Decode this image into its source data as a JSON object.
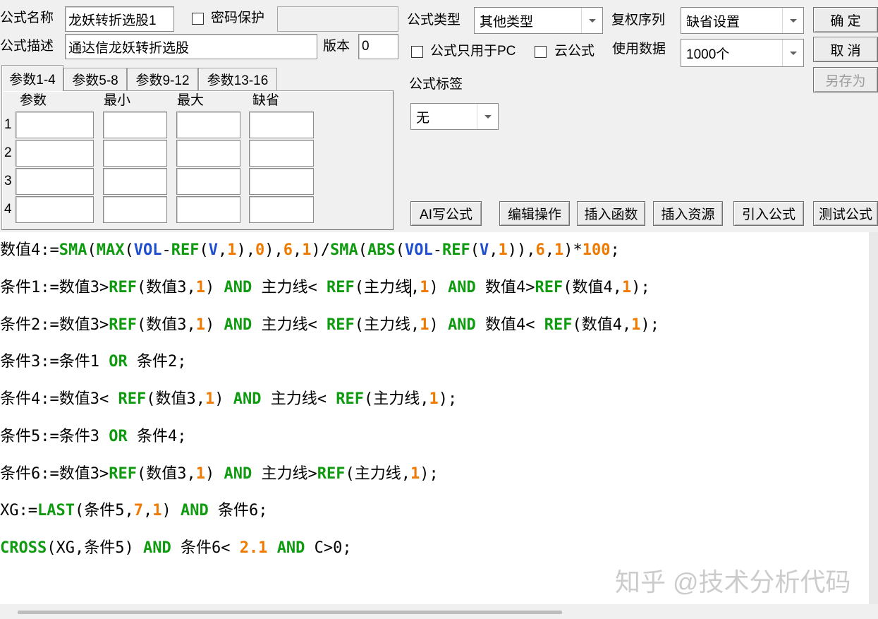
{
  "form": {
    "name_label": "公式名称",
    "name_value": "龙妖转折选股1",
    "password_label": "密码保护",
    "password_checked": false,
    "password_value": "",
    "desc_label": "公式描述",
    "desc_value": "通达信龙妖转折选股",
    "version_label": "版本",
    "version_value": "0",
    "type_label": "公式类型",
    "type_value": "其他类型",
    "adjust_label": "复权序列",
    "adjust_value": "缺省设置",
    "pc_only_label": "公式只用于PC",
    "pc_only_checked": false,
    "cloud_label": "云公式",
    "cloud_checked": false,
    "data_label": "使用数据",
    "data_value": "1000个",
    "tag_label": "公式标签",
    "tag_value": "无"
  },
  "buttons": {
    "ok": "确 定",
    "cancel": "取 消",
    "save_as": "另存为",
    "save_as_disabled": true,
    "ai_write": "AI写公式",
    "edit_ops": "编辑操作",
    "insert_function": "插入函数",
    "insert_resource": "插入资源",
    "import_formula": "引入公式",
    "test_formula": "测试公式"
  },
  "params": {
    "tabs": [
      {
        "label": "参数1-4",
        "active": true
      },
      {
        "label": "参数5-8",
        "active": false
      },
      {
        "label": "参数9-12",
        "active": false
      },
      {
        "label": "参数13-16",
        "active": false
      }
    ],
    "headers": {
      "name": "参数",
      "min": "最小",
      "max": "最大",
      "default": "缺省"
    },
    "rows": [
      {
        "index": "1",
        "name": "",
        "min": "",
        "max": "",
        "default": ""
      },
      {
        "index": "2",
        "name": "",
        "min": "",
        "max": "",
        "default": ""
      },
      {
        "index": "3",
        "name": "",
        "min": "",
        "max": "",
        "default": ""
      },
      {
        "index": "4",
        "name": "",
        "min": "",
        "max": "",
        "default": ""
      }
    ]
  },
  "editor": {
    "lines": [
      [
        {
          "s": "数值4:=",
          "k": "text"
        },
        {
          "s": "SMA",
          "k": "func"
        },
        {
          "s": "(",
          "k": "text"
        },
        {
          "s": "MAX",
          "k": "func"
        },
        {
          "s": "(",
          "k": "text"
        },
        {
          "s": "VOL",
          "k": "var"
        },
        {
          "s": "-",
          "k": "text"
        },
        {
          "s": "REF",
          "k": "func"
        },
        {
          "s": "(",
          "k": "text"
        },
        {
          "s": "V",
          "k": "var"
        },
        {
          "s": ",",
          "k": "text"
        },
        {
          "s": "1",
          "k": "num"
        },
        {
          "s": "),",
          "k": "text"
        },
        {
          "s": "0",
          "k": "num"
        },
        {
          "s": "),",
          "k": "text"
        },
        {
          "s": "6",
          "k": "num"
        },
        {
          "s": ",",
          "k": "text"
        },
        {
          "s": "1",
          "k": "num"
        },
        {
          "s": ")/",
          "k": "text"
        },
        {
          "s": "SMA",
          "k": "func"
        },
        {
          "s": "(",
          "k": "text"
        },
        {
          "s": "ABS",
          "k": "func"
        },
        {
          "s": "(",
          "k": "text"
        },
        {
          "s": "VOL",
          "k": "var"
        },
        {
          "s": "-",
          "k": "text"
        },
        {
          "s": "REF",
          "k": "func"
        },
        {
          "s": "(",
          "k": "text"
        },
        {
          "s": "V",
          "k": "var"
        },
        {
          "s": ",",
          "k": "text"
        },
        {
          "s": "1",
          "k": "num"
        },
        {
          "s": ")),",
          "k": "text"
        },
        {
          "s": "6",
          "k": "num"
        },
        {
          "s": ",",
          "k": "text"
        },
        {
          "s": "1",
          "k": "num"
        },
        {
          "s": ")*",
          "k": "text"
        },
        {
          "s": "100",
          "k": "num"
        },
        {
          "s": ";",
          "k": "text"
        }
      ],
      [
        {
          "s": "条件1:=数值3>",
          "k": "text"
        },
        {
          "s": "REF",
          "k": "func"
        },
        {
          "s": "(数值3,",
          "k": "text"
        },
        {
          "s": "1",
          "k": "num"
        },
        {
          "s": ") ",
          "k": "text"
        },
        {
          "s": "AND",
          "k": "func"
        },
        {
          "s": " 主力线< ",
          "k": "text"
        },
        {
          "s": "REF",
          "k": "func"
        },
        {
          "s": "(主力线",
          "k": "text"
        },
        {
          "k": "caret"
        },
        {
          "s": ",",
          "k": "text"
        },
        {
          "s": "1",
          "k": "num"
        },
        {
          "s": ") ",
          "k": "text"
        },
        {
          "s": "AND",
          "k": "func"
        },
        {
          "s": " 数值4>",
          "k": "text"
        },
        {
          "s": "REF",
          "k": "func"
        },
        {
          "s": "(数值4,",
          "k": "text"
        },
        {
          "s": "1",
          "k": "num"
        },
        {
          "s": ");",
          "k": "text"
        }
      ],
      [
        {
          "s": "条件2:=数值3>",
          "k": "text"
        },
        {
          "s": "REF",
          "k": "func"
        },
        {
          "s": "(数值3,",
          "k": "text"
        },
        {
          "s": "1",
          "k": "num"
        },
        {
          "s": ") ",
          "k": "text"
        },
        {
          "s": "AND",
          "k": "func"
        },
        {
          "s": " 主力线< ",
          "k": "text"
        },
        {
          "s": "REF",
          "k": "func"
        },
        {
          "s": "(主力线,",
          "k": "text"
        },
        {
          "s": "1",
          "k": "num"
        },
        {
          "s": ") ",
          "k": "text"
        },
        {
          "s": "AND",
          "k": "func"
        },
        {
          "s": " 数值4< ",
          "k": "text"
        },
        {
          "s": "REF",
          "k": "func"
        },
        {
          "s": "(数值4,",
          "k": "text"
        },
        {
          "s": "1",
          "k": "num"
        },
        {
          "s": ");",
          "k": "text"
        }
      ],
      [
        {
          "s": "条件3:=条件1 ",
          "k": "text"
        },
        {
          "s": "OR",
          "k": "func"
        },
        {
          "s": " 条件2;",
          "k": "text"
        }
      ],
      [
        {
          "s": "条件4:=数值3< ",
          "k": "text"
        },
        {
          "s": "REF",
          "k": "func"
        },
        {
          "s": "(数值3,",
          "k": "text"
        },
        {
          "s": "1",
          "k": "num"
        },
        {
          "s": ") ",
          "k": "text"
        },
        {
          "s": "AND",
          "k": "func"
        },
        {
          "s": " 主力线< ",
          "k": "text"
        },
        {
          "s": "REF",
          "k": "func"
        },
        {
          "s": "(主力线,",
          "k": "text"
        },
        {
          "s": "1",
          "k": "num"
        },
        {
          "s": ");",
          "k": "text"
        }
      ],
      [
        {
          "s": "条件5:=条件3 ",
          "k": "text"
        },
        {
          "s": "OR",
          "k": "func"
        },
        {
          "s": " 条件4;",
          "k": "text"
        }
      ],
      [
        {
          "s": "条件6:=数值3>",
          "k": "text"
        },
        {
          "s": "REF",
          "k": "func"
        },
        {
          "s": "(数值3,",
          "k": "text"
        },
        {
          "s": "1",
          "k": "num"
        },
        {
          "s": ") ",
          "k": "text"
        },
        {
          "s": "AND",
          "k": "func"
        },
        {
          "s": " 主力线>",
          "k": "text"
        },
        {
          "s": "REF",
          "k": "func"
        },
        {
          "s": "(主力线,",
          "k": "text"
        },
        {
          "s": "1",
          "k": "num"
        },
        {
          "s": ");",
          "k": "text"
        }
      ],
      [
        {
          "s": "XG:=",
          "k": "text"
        },
        {
          "s": "LAST",
          "k": "func"
        },
        {
          "s": "(条件5,",
          "k": "text"
        },
        {
          "s": "7",
          "k": "num"
        },
        {
          "s": ",",
          "k": "text"
        },
        {
          "s": "1",
          "k": "num"
        },
        {
          "s": ") ",
          "k": "text"
        },
        {
          "s": "AND",
          "k": "func"
        },
        {
          "s": " 条件6;",
          "k": "text"
        }
      ],
      [
        {
          "s": "CROSS",
          "k": "func"
        },
        {
          "s": "(XG,条件5) ",
          "k": "text"
        },
        {
          "s": "AND",
          "k": "func"
        },
        {
          "s": " 条件6< ",
          "k": "text"
        },
        {
          "s": "2.1",
          "k": "num"
        },
        {
          "s": " ",
          "k": "text"
        },
        {
          "s": "AND",
          "k": "func"
        },
        {
          "s": " C>0;",
          "k": "text"
        }
      ]
    ]
  },
  "colors": {
    "func": "#0f9b0f",
    "var": "#1f4ed0",
    "num": "#f07a00",
    "text": "#000000",
    "watermark": "#cccccc"
  },
  "watermark": "知乎 @技术分析代码"
}
